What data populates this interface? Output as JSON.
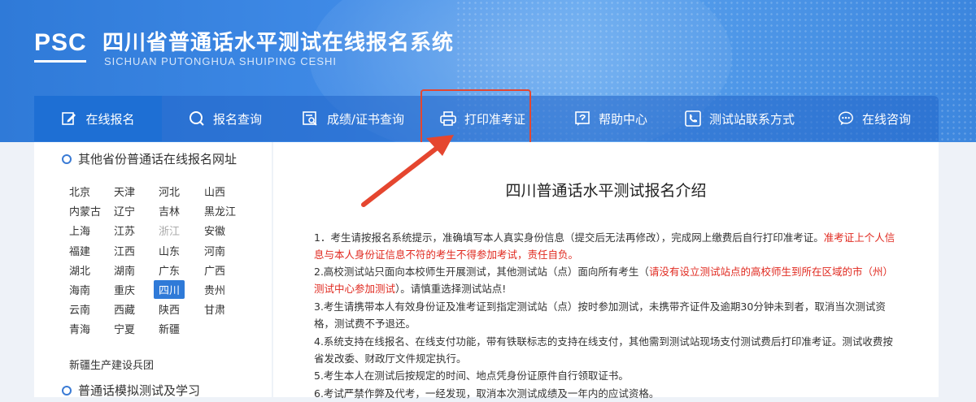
{
  "header": {
    "logo_text": "PSC",
    "title_cn": "四川省普通话水平测试在线报名系统",
    "title_en": "SICHUAN PUTONGHUA SHUIPING CESHI"
  },
  "nav": [
    {
      "label": "在线报名",
      "icon": "edit-icon",
      "active": true
    },
    {
      "label": "报名查询",
      "icon": "search-icon"
    },
    {
      "label": "成绩/证书查询",
      "icon": "certificate-search-icon"
    },
    {
      "label": "打印准考证",
      "icon": "printer-icon"
    },
    {
      "label": "帮助中心",
      "icon": "help-icon"
    },
    {
      "label": "测试站联系方式",
      "icon": "phone-icon"
    },
    {
      "label": "在线咨询",
      "icon": "chat-icon"
    }
  ],
  "sidebar": {
    "section1_title": "其他省份普通话在线报名网址",
    "provinces": [
      "北京",
      "天津",
      "河北",
      "山西",
      "内蒙古",
      "辽宁",
      "吉林",
      "黑龙江",
      "上海",
      "江苏",
      "浙江",
      "安徽",
      "福建",
      "江西",
      "山东",
      "河南",
      "湖北",
      "湖南",
      "广东",
      "广西",
      "海南",
      "重庆",
      "四川",
      "贵州",
      "云南",
      "西藏",
      "陕西",
      "甘肃",
      "青海",
      "宁夏",
      "新疆"
    ],
    "extra": "新疆生产建设兵团",
    "section2_title": "普通话模拟测试及学习"
  },
  "main": {
    "title": "四川普通话水平测试报名介绍",
    "p1_a": "1．考生请按报名系统提示，准确填写本人真实身份信息（提交后无法再修改），完成网上缴费后自行打印准考证。",
    "p1_red": "准考证上个人信息与本人身份证信息不符的考生不得参加考试，责任自负。",
    "p2_a": "2.高校测试站只面向本校师生开展测试，其他测试站（点）面向所有考生（",
    "p2_red": "请没有设立测试站点的高校师生到所在区域的市（州）测试中心参加测试",
    "p2_b": "）。请慎重选择测试站点!",
    "p3": "3.考生请携带本人有效身份证及准考证到指定测试站（点）按时参加测试，未携带齐证件及逾期30分钟未到者，取消当次测试资格，测试费不予退还。",
    "p4": "4.系统支持在线报名、在线支付功能，带有铁联标志的支持在线支付，其他需到测试站现场支付测试费后打印准考证。测试收费按省发改委、财政厅文件规定执行。",
    "p5": "5.考生本人在测试后按规定的时间、地点凭身份证原件自行领取证书。",
    "p6": "6.考试严禁作弊及代考，一经发现，取消本次测试成绩及一年内的应试资格。"
  },
  "colors": {
    "header_blue": "#2f7ad8",
    "annotation_red": "#e5462f",
    "notice_red": "#e02a20"
  }
}
